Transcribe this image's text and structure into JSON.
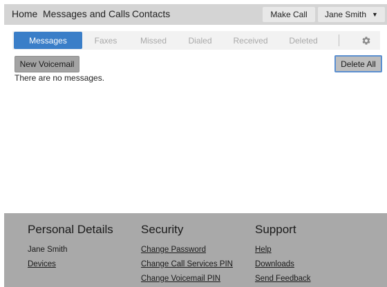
{
  "header": {
    "nav": [
      {
        "label": "Home"
      },
      {
        "label": "Messages and Calls"
      },
      {
        "label": "Contacts"
      }
    ],
    "make_call_label": "Make Call",
    "user_name": "Jane Smith",
    "user_menu_icon": "chevron-down-icon"
  },
  "tabs": [
    {
      "label": "Messages",
      "active": true
    },
    {
      "label": "Faxes",
      "active": false
    },
    {
      "label": "Missed",
      "active": false
    },
    {
      "label": "Dialed",
      "active": false
    },
    {
      "label": "Received",
      "active": false
    },
    {
      "label": "Deleted",
      "active": false
    }
  ],
  "settings_icon": "gear-icon",
  "toolbar": {
    "new_voicemail_label": "New Voicemail",
    "delete_all_label": "Delete All"
  },
  "messages": {
    "empty_text": "There are no messages."
  },
  "footer": {
    "personal": {
      "heading": "Personal Details",
      "name": "Jane Smith",
      "devices": "Devices"
    },
    "security": {
      "heading": "Security",
      "change_password": "Change Password",
      "change_call_pin": "Change Call Services PIN",
      "change_voicemail_pin": "Change Voicemail PIN"
    },
    "support": {
      "heading": "Support",
      "help": "Help",
      "downloads": "Downloads",
      "send_feedback": "Send Feedback"
    }
  },
  "colors": {
    "accent": "#3a7ec8",
    "topbar": "#d4d4d4",
    "footer": "#a9a9a9"
  }
}
